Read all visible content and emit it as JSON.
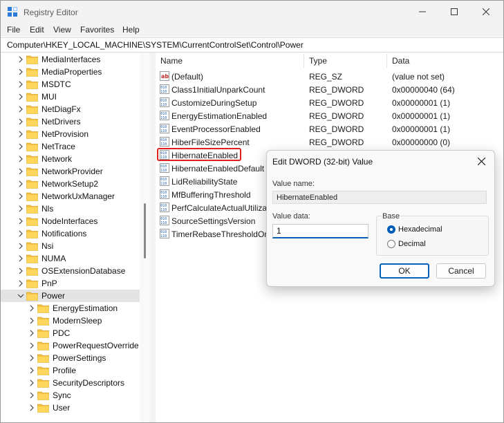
{
  "window": {
    "title": "Registry Editor"
  },
  "menu": [
    "File",
    "Edit",
    "View",
    "Favorites",
    "Help"
  ],
  "address": "Computer\\HKEY_LOCAL_MACHINE\\SYSTEM\\CurrentControlSet\\Control\\Power",
  "tree": {
    "items": [
      {
        "label": "MediaInterfaces",
        "level": 0
      },
      {
        "label": "MediaProperties",
        "level": 0
      },
      {
        "label": "MSDTC",
        "level": 0
      },
      {
        "label": "MUI",
        "level": 0
      },
      {
        "label": "NetDiagFx",
        "level": 0
      },
      {
        "label": "NetDrivers",
        "level": 0
      },
      {
        "label": "NetProvision",
        "level": 0
      },
      {
        "label": "NetTrace",
        "level": 0
      },
      {
        "label": "Network",
        "level": 0
      },
      {
        "label": "NetworkProvider",
        "level": 0
      },
      {
        "label": "NetworkSetup2",
        "level": 0
      },
      {
        "label": "NetworkUxManager",
        "level": 0
      },
      {
        "label": "Nls",
        "level": 0
      },
      {
        "label": "NodeInterfaces",
        "level": 0
      },
      {
        "label": "Notifications",
        "level": 0
      },
      {
        "label": "Nsi",
        "level": 0
      },
      {
        "label": "NUMA",
        "level": 0
      },
      {
        "label": "OSExtensionDatabase",
        "level": 0
      },
      {
        "label": "PnP",
        "level": 0
      },
      {
        "label": "Power",
        "level": 0,
        "expanded": true,
        "selected": true
      },
      {
        "label": "EnergyEstimation",
        "level": 1
      },
      {
        "label": "ModernSleep",
        "level": 1
      },
      {
        "label": "PDC",
        "level": 1
      },
      {
        "label": "PowerRequestOverride",
        "level": 1
      },
      {
        "label": "PowerSettings",
        "level": 1
      },
      {
        "label": "Profile",
        "level": 1
      },
      {
        "label": "SecurityDescriptors",
        "level": 1
      },
      {
        "label": "Sync",
        "level": 1
      },
      {
        "label": "User",
        "level": 1
      }
    ]
  },
  "list": {
    "headers": {
      "name": "Name",
      "type": "Type",
      "data": "Data"
    },
    "rows": [
      {
        "icon": "string-value-icon",
        "name": "(Default)",
        "type": "REG_SZ",
        "data": "(value not set)"
      },
      {
        "icon": "dword-value-icon",
        "name": "Class1InitialUnparkCount",
        "type": "REG_DWORD",
        "data": "0x00000040 (64)"
      },
      {
        "icon": "dword-value-icon",
        "name": "CustomizeDuringSetup",
        "type": "REG_DWORD",
        "data": "0x00000001 (1)"
      },
      {
        "icon": "dword-value-icon",
        "name": "EnergyEstimationEnabled",
        "type": "REG_DWORD",
        "data": "0x00000001 (1)"
      },
      {
        "icon": "dword-value-icon",
        "name": "EventProcessorEnabled",
        "type": "REG_DWORD",
        "data": "0x00000001 (1)"
      },
      {
        "icon": "dword-value-icon",
        "name": "HiberFileSizePercent",
        "type": "REG_DWORD",
        "data": "0x00000000 (0)"
      },
      {
        "icon": "dword-value-icon",
        "name": "HibernateEnabled",
        "type": "",
        "data": "",
        "highlighted": true
      },
      {
        "icon": "dword-value-icon",
        "name": "HibernateEnabledDefault",
        "type": "",
        "data": ""
      },
      {
        "icon": "dword-value-icon",
        "name": "LidReliabilityState",
        "type": "",
        "data": ""
      },
      {
        "icon": "dword-value-icon",
        "name": "MfBufferingThreshold",
        "type": "",
        "data": ""
      },
      {
        "icon": "dword-value-icon",
        "name": "PerfCalculateActualUtiliza",
        "type": "",
        "data": ""
      },
      {
        "icon": "dword-value-icon",
        "name": "SourceSettingsVersion",
        "type": "",
        "data": ""
      },
      {
        "icon": "dword-value-icon",
        "name": "TimerRebaseThresholdOnI",
        "type": "",
        "data": ""
      }
    ]
  },
  "dialog": {
    "title": "Edit DWORD (32-bit) Value",
    "value_name_label": "Value name:",
    "value_name": "HibernateEnabled",
    "value_data_label": "Value data:",
    "value_data": "1",
    "base_label": "Base",
    "base_options": [
      {
        "label": "Hexadecimal",
        "selected": true
      },
      {
        "label": "Decimal",
        "selected": false
      }
    ],
    "ok_label": "OK",
    "cancel_label": "Cancel"
  },
  "colors": {
    "accent": "#005fb8",
    "highlight_border": "#e02020",
    "folder": "#f5c143"
  }
}
